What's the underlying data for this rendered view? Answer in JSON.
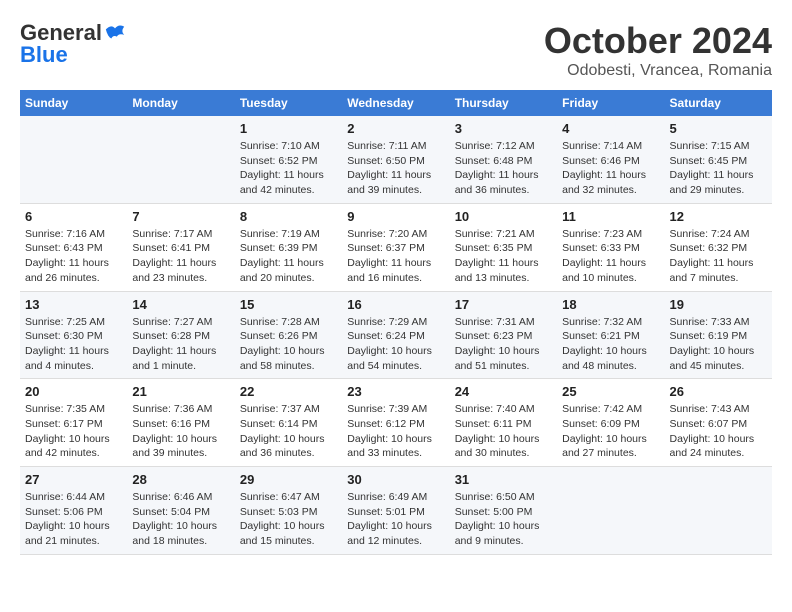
{
  "header": {
    "logo_general": "General",
    "logo_blue": "Blue",
    "month": "October 2024",
    "location": "Odobesti, Vrancea, Romania"
  },
  "weekdays": [
    "Sunday",
    "Monday",
    "Tuesday",
    "Wednesday",
    "Thursday",
    "Friday",
    "Saturday"
  ],
  "weeks": [
    [
      {
        "day": "",
        "info": ""
      },
      {
        "day": "",
        "info": ""
      },
      {
        "day": "1",
        "info": "Sunrise: 7:10 AM\nSunset: 6:52 PM\nDaylight: 11 hours and 42 minutes."
      },
      {
        "day": "2",
        "info": "Sunrise: 7:11 AM\nSunset: 6:50 PM\nDaylight: 11 hours and 39 minutes."
      },
      {
        "day": "3",
        "info": "Sunrise: 7:12 AM\nSunset: 6:48 PM\nDaylight: 11 hours and 36 minutes."
      },
      {
        "day": "4",
        "info": "Sunrise: 7:14 AM\nSunset: 6:46 PM\nDaylight: 11 hours and 32 minutes."
      },
      {
        "day": "5",
        "info": "Sunrise: 7:15 AM\nSunset: 6:45 PM\nDaylight: 11 hours and 29 minutes."
      }
    ],
    [
      {
        "day": "6",
        "info": "Sunrise: 7:16 AM\nSunset: 6:43 PM\nDaylight: 11 hours and 26 minutes."
      },
      {
        "day": "7",
        "info": "Sunrise: 7:17 AM\nSunset: 6:41 PM\nDaylight: 11 hours and 23 minutes."
      },
      {
        "day": "8",
        "info": "Sunrise: 7:19 AM\nSunset: 6:39 PM\nDaylight: 11 hours and 20 minutes."
      },
      {
        "day": "9",
        "info": "Sunrise: 7:20 AM\nSunset: 6:37 PM\nDaylight: 11 hours and 16 minutes."
      },
      {
        "day": "10",
        "info": "Sunrise: 7:21 AM\nSunset: 6:35 PM\nDaylight: 11 hours and 13 minutes."
      },
      {
        "day": "11",
        "info": "Sunrise: 7:23 AM\nSunset: 6:33 PM\nDaylight: 11 hours and 10 minutes."
      },
      {
        "day": "12",
        "info": "Sunrise: 7:24 AM\nSunset: 6:32 PM\nDaylight: 11 hours and 7 minutes."
      }
    ],
    [
      {
        "day": "13",
        "info": "Sunrise: 7:25 AM\nSunset: 6:30 PM\nDaylight: 11 hours and 4 minutes."
      },
      {
        "day": "14",
        "info": "Sunrise: 7:27 AM\nSunset: 6:28 PM\nDaylight: 11 hours and 1 minute."
      },
      {
        "day": "15",
        "info": "Sunrise: 7:28 AM\nSunset: 6:26 PM\nDaylight: 10 hours and 58 minutes."
      },
      {
        "day": "16",
        "info": "Sunrise: 7:29 AM\nSunset: 6:24 PM\nDaylight: 10 hours and 54 minutes."
      },
      {
        "day": "17",
        "info": "Sunrise: 7:31 AM\nSunset: 6:23 PM\nDaylight: 10 hours and 51 minutes."
      },
      {
        "day": "18",
        "info": "Sunrise: 7:32 AM\nSunset: 6:21 PM\nDaylight: 10 hours and 48 minutes."
      },
      {
        "day": "19",
        "info": "Sunrise: 7:33 AM\nSunset: 6:19 PM\nDaylight: 10 hours and 45 minutes."
      }
    ],
    [
      {
        "day": "20",
        "info": "Sunrise: 7:35 AM\nSunset: 6:17 PM\nDaylight: 10 hours and 42 minutes."
      },
      {
        "day": "21",
        "info": "Sunrise: 7:36 AM\nSunset: 6:16 PM\nDaylight: 10 hours and 39 minutes."
      },
      {
        "day": "22",
        "info": "Sunrise: 7:37 AM\nSunset: 6:14 PM\nDaylight: 10 hours and 36 minutes."
      },
      {
        "day": "23",
        "info": "Sunrise: 7:39 AM\nSunset: 6:12 PM\nDaylight: 10 hours and 33 minutes."
      },
      {
        "day": "24",
        "info": "Sunrise: 7:40 AM\nSunset: 6:11 PM\nDaylight: 10 hours and 30 minutes."
      },
      {
        "day": "25",
        "info": "Sunrise: 7:42 AM\nSunset: 6:09 PM\nDaylight: 10 hours and 27 minutes."
      },
      {
        "day": "26",
        "info": "Sunrise: 7:43 AM\nSunset: 6:07 PM\nDaylight: 10 hours and 24 minutes."
      }
    ],
    [
      {
        "day": "27",
        "info": "Sunrise: 6:44 AM\nSunset: 5:06 PM\nDaylight: 10 hours and 21 minutes."
      },
      {
        "day": "28",
        "info": "Sunrise: 6:46 AM\nSunset: 5:04 PM\nDaylight: 10 hours and 18 minutes."
      },
      {
        "day": "29",
        "info": "Sunrise: 6:47 AM\nSunset: 5:03 PM\nDaylight: 10 hours and 15 minutes."
      },
      {
        "day": "30",
        "info": "Sunrise: 6:49 AM\nSunset: 5:01 PM\nDaylight: 10 hours and 12 minutes."
      },
      {
        "day": "31",
        "info": "Sunrise: 6:50 AM\nSunset: 5:00 PM\nDaylight: 10 hours and 9 minutes."
      },
      {
        "day": "",
        "info": ""
      },
      {
        "day": "",
        "info": ""
      }
    ]
  ]
}
